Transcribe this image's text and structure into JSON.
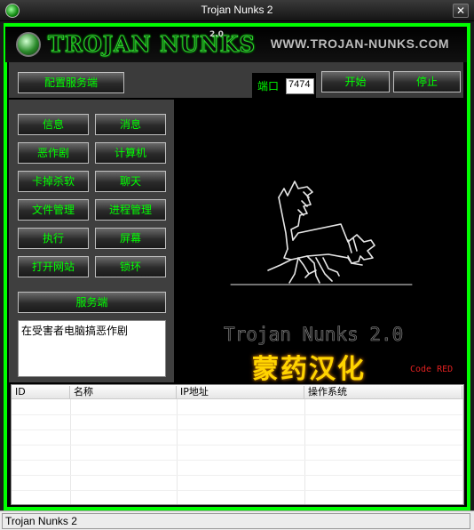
{
  "window": {
    "title": "Trojan Nunks 2"
  },
  "header": {
    "logo_text": "TROJAN NUNKS",
    "logo_version": "2.0",
    "site_url": "WWW.TROJAN-NUNKS.COM"
  },
  "toolbar": {
    "config_server_label": "配置服务端",
    "port_label": "端口",
    "port_value": "7474",
    "start_label": "开始",
    "stop_label": "停止"
  },
  "left_buttons": [
    "信息",
    "消息",
    "恶作剧",
    "计算机",
    "卡掉杀软",
    "聊天",
    "文件管理",
    "进程管理",
    "执行",
    "屏幕",
    "打开网站",
    "锁环"
  ],
  "server_button_label": "服务端",
  "description_text": "在受害者电脑搞恶作剧",
  "art": {
    "title": "Trojan Nunks 2.0",
    "chinese": "蒙药汉化",
    "credit": "Code RED"
  },
  "table": {
    "columns": [
      "ID",
      "名称",
      "IP地址",
      "操作系统"
    ]
  },
  "status": {
    "text": "Trojan Nunks 2"
  },
  "colors": {
    "accent": "#00ff00",
    "frame": "#00ff00",
    "gold": "#ffd400",
    "credit": "#e02020"
  }
}
